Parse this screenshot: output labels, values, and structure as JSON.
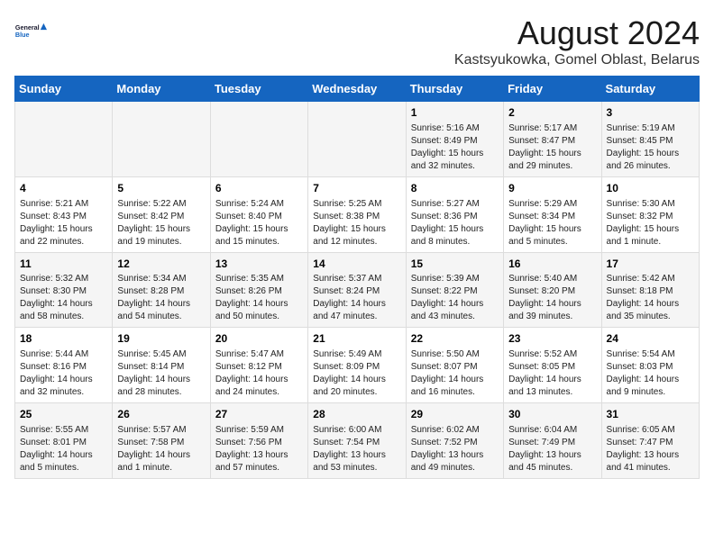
{
  "logo": {
    "line1": "General",
    "line2": "Blue"
  },
  "title": "August 2024",
  "subtitle": "Kastsyukowka, Gomel Oblast, Belarus",
  "days_of_week": [
    "Sunday",
    "Monday",
    "Tuesday",
    "Wednesday",
    "Thursday",
    "Friday",
    "Saturday"
  ],
  "weeks": [
    [
      {
        "day": "",
        "content": ""
      },
      {
        "day": "",
        "content": ""
      },
      {
        "day": "",
        "content": ""
      },
      {
        "day": "",
        "content": ""
      },
      {
        "day": "1",
        "content": "Sunrise: 5:16 AM\nSunset: 8:49 PM\nDaylight: 15 hours\nand 32 minutes."
      },
      {
        "day": "2",
        "content": "Sunrise: 5:17 AM\nSunset: 8:47 PM\nDaylight: 15 hours\nand 29 minutes."
      },
      {
        "day": "3",
        "content": "Sunrise: 5:19 AM\nSunset: 8:45 PM\nDaylight: 15 hours\nand 26 minutes."
      }
    ],
    [
      {
        "day": "4",
        "content": "Sunrise: 5:21 AM\nSunset: 8:43 PM\nDaylight: 15 hours\nand 22 minutes."
      },
      {
        "day": "5",
        "content": "Sunrise: 5:22 AM\nSunset: 8:42 PM\nDaylight: 15 hours\nand 19 minutes."
      },
      {
        "day": "6",
        "content": "Sunrise: 5:24 AM\nSunset: 8:40 PM\nDaylight: 15 hours\nand 15 minutes."
      },
      {
        "day": "7",
        "content": "Sunrise: 5:25 AM\nSunset: 8:38 PM\nDaylight: 15 hours\nand 12 minutes."
      },
      {
        "day": "8",
        "content": "Sunrise: 5:27 AM\nSunset: 8:36 PM\nDaylight: 15 hours\nand 8 minutes."
      },
      {
        "day": "9",
        "content": "Sunrise: 5:29 AM\nSunset: 8:34 PM\nDaylight: 15 hours\nand 5 minutes."
      },
      {
        "day": "10",
        "content": "Sunrise: 5:30 AM\nSunset: 8:32 PM\nDaylight: 15 hours\nand 1 minute."
      }
    ],
    [
      {
        "day": "11",
        "content": "Sunrise: 5:32 AM\nSunset: 8:30 PM\nDaylight: 14 hours\nand 58 minutes."
      },
      {
        "day": "12",
        "content": "Sunrise: 5:34 AM\nSunset: 8:28 PM\nDaylight: 14 hours\nand 54 minutes."
      },
      {
        "day": "13",
        "content": "Sunrise: 5:35 AM\nSunset: 8:26 PM\nDaylight: 14 hours\nand 50 minutes."
      },
      {
        "day": "14",
        "content": "Sunrise: 5:37 AM\nSunset: 8:24 PM\nDaylight: 14 hours\nand 47 minutes."
      },
      {
        "day": "15",
        "content": "Sunrise: 5:39 AM\nSunset: 8:22 PM\nDaylight: 14 hours\nand 43 minutes."
      },
      {
        "day": "16",
        "content": "Sunrise: 5:40 AM\nSunset: 8:20 PM\nDaylight: 14 hours\nand 39 minutes."
      },
      {
        "day": "17",
        "content": "Sunrise: 5:42 AM\nSunset: 8:18 PM\nDaylight: 14 hours\nand 35 minutes."
      }
    ],
    [
      {
        "day": "18",
        "content": "Sunrise: 5:44 AM\nSunset: 8:16 PM\nDaylight: 14 hours\nand 32 minutes."
      },
      {
        "day": "19",
        "content": "Sunrise: 5:45 AM\nSunset: 8:14 PM\nDaylight: 14 hours\nand 28 minutes."
      },
      {
        "day": "20",
        "content": "Sunrise: 5:47 AM\nSunset: 8:12 PM\nDaylight: 14 hours\nand 24 minutes."
      },
      {
        "day": "21",
        "content": "Sunrise: 5:49 AM\nSunset: 8:09 PM\nDaylight: 14 hours\nand 20 minutes."
      },
      {
        "day": "22",
        "content": "Sunrise: 5:50 AM\nSunset: 8:07 PM\nDaylight: 14 hours\nand 16 minutes."
      },
      {
        "day": "23",
        "content": "Sunrise: 5:52 AM\nSunset: 8:05 PM\nDaylight: 14 hours\nand 13 minutes."
      },
      {
        "day": "24",
        "content": "Sunrise: 5:54 AM\nSunset: 8:03 PM\nDaylight: 14 hours\nand 9 minutes."
      }
    ],
    [
      {
        "day": "25",
        "content": "Sunrise: 5:55 AM\nSunset: 8:01 PM\nDaylight: 14 hours\nand 5 minutes."
      },
      {
        "day": "26",
        "content": "Sunrise: 5:57 AM\nSunset: 7:58 PM\nDaylight: 14 hours\nand 1 minute."
      },
      {
        "day": "27",
        "content": "Sunrise: 5:59 AM\nSunset: 7:56 PM\nDaylight: 13 hours\nand 57 minutes."
      },
      {
        "day": "28",
        "content": "Sunrise: 6:00 AM\nSunset: 7:54 PM\nDaylight: 13 hours\nand 53 minutes."
      },
      {
        "day": "29",
        "content": "Sunrise: 6:02 AM\nSunset: 7:52 PM\nDaylight: 13 hours\nand 49 minutes."
      },
      {
        "day": "30",
        "content": "Sunrise: 6:04 AM\nSunset: 7:49 PM\nDaylight: 13 hours\nand 45 minutes."
      },
      {
        "day": "31",
        "content": "Sunrise: 6:05 AM\nSunset: 7:47 PM\nDaylight: 13 hours\nand 41 minutes."
      }
    ]
  ]
}
